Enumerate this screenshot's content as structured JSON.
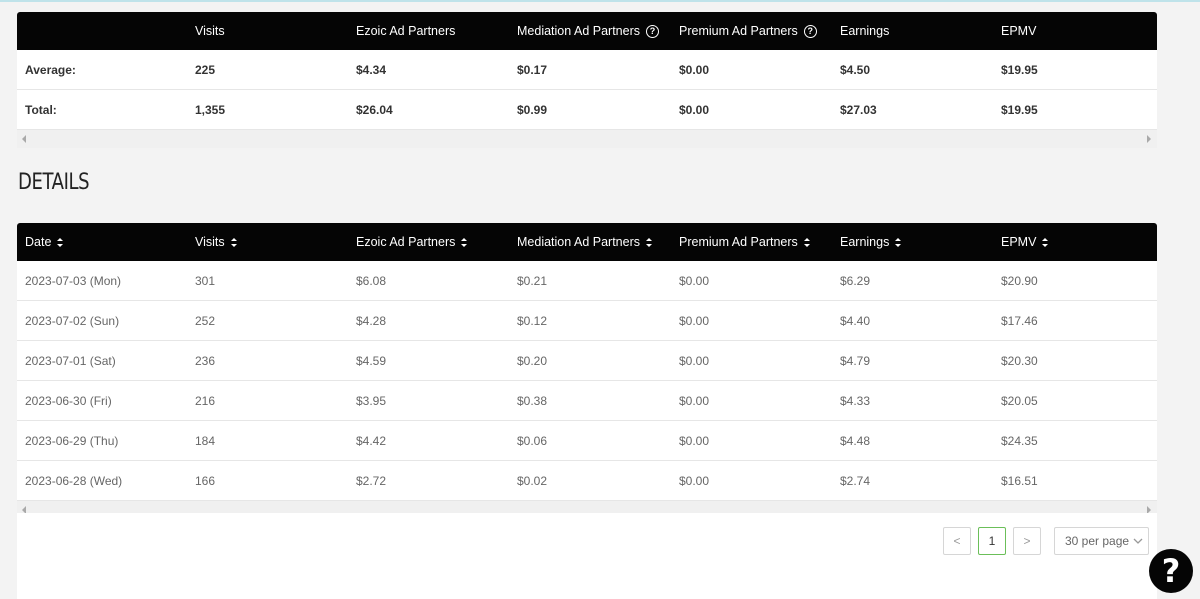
{
  "summary": {
    "columns": [
      "",
      "Visits",
      "Ezoic Ad Partners",
      "Mediation Ad Partners",
      "Premium Ad Partners",
      "Earnings",
      "EPMV"
    ],
    "rows": [
      {
        "label": "Average:",
        "visits": "225",
        "ezoic": "$4.34",
        "mediation": "$0.17",
        "premium": "$0.00",
        "earnings": "$4.50",
        "epmv": "$19.95"
      },
      {
        "label": "Total:",
        "visits": "1,355",
        "ezoic": "$26.04",
        "mediation": "$0.99",
        "premium": "$0.00",
        "earnings": "$27.03",
        "epmv": "$19.95"
      }
    ]
  },
  "details": {
    "title": "DETAILS",
    "columns": [
      "Date",
      "Visits",
      "Ezoic Ad Partners",
      "Mediation Ad Partners",
      "Premium Ad Partners",
      "Earnings",
      "EPMV"
    ],
    "rows": [
      {
        "date": "2023-07-03 (Mon)",
        "visits": "301",
        "ezoic": "$6.08",
        "mediation": "$0.21",
        "premium": "$0.00",
        "earnings": "$6.29",
        "epmv": "$20.90"
      },
      {
        "date": "2023-07-02 (Sun)",
        "visits": "252",
        "ezoic": "$4.28",
        "mediation": "$0.12",
        "premium": "$0.00",
        "earnings": "$4.40",
        "epmv": "$17.46"
      },
      {
        "date": "2023-07-01 (Sat)",
        "visits": "236",
        "ezoic": "$4.59",
        "mediation": "$0.20",
        "premium": "$0.00",
        "earnings": "$4.79",
        "epmv": "$20.30"
      },
      {
        "date": "2023-06-30 (Fri)",
        "visits": "216",
        "ezoic": "$3.95",
        "mediation": "$0.38",
        "premium": "$0.00",
        "earnings": "$4.33",
        "epmv": "$20.05"
      },
      {
        "date": "2023-06-29 (Thu)",
        "visits": "184",
        "ezoic": "$4.42",
        "mediation": "$0.06",
        "premium": "$0.00",
        "earnings": "$4.48",
        "epmv": "$24.35"
      },
      {
        "date": "2023-06-28 (Wed)",
        "visits": "166",
        "ezoic": "$2.72",
        "mediation": "$0.02",
        "premium": "$0.00",
        "earnings": "$2.74",
        "epmv": "$16.51"
      }
    ]
  },
  "pagination": {
    "prev": "<",
    "current": "1",
    "next": ">",
    "per_page": "30 per page"
  },
  "help": {
    "label": "?"
  },
  "icons": {
    "help_circle": "question-circle-icon",
    "sort": "sort-icon"
  },
  "colors": {
    "header_bg": "#050505",
    "active_page_border": "#6bbf59"
  }
}
